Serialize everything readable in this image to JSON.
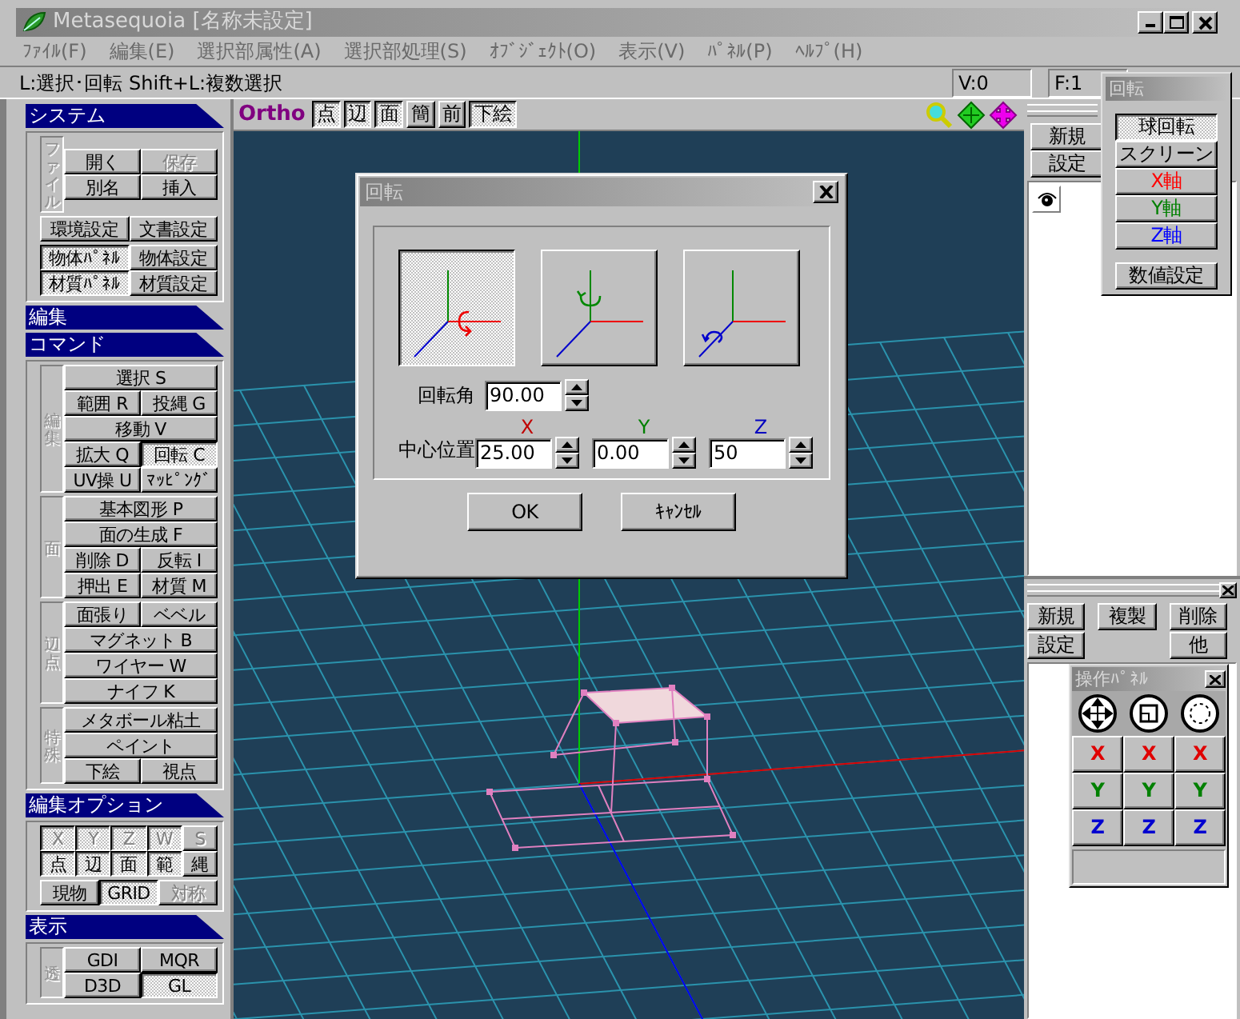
{
  "window": {
    "title": "Metasequoia [名称未設定]"
  },
  "menu": [
    "ﾌｧｲﾙ(F)",
    "編集(E)",
    "選択部属性(A)",
    "選択部処理(S)",
    "ｵﾌﾞｼﾞｪｸﾄ(O)",
    "表示(V)",
    "ﾊﾟﾈﾙ(P)",
    "ﾍﾙﾌﾟ(H)"
  ],
  "status": {
    "hint": "L:選択･回転  Shift+L:複数選択",
    "vertex_count": "V:0",
    "face_count": "F:1"
  },
  "sidebar": [
    {
      "title": "システム",
      "groups": [
        {
          "label": "ファイル",
          "rows": [
            [
              {
                "label": "開く",
                "pressed": false,
                "disabled": false
              },
              {
                "label": "保存",
                "pressed": false,
                "disabled": true
              }
            ],
            [
              {
                "label": "別名",
                "pressed": false,
                "disabled": false
              },
              {
                "label": "挿入",
                "pressed": false,
                "disabled": false
              }
            ]
          ]
        },
        {
          "rows": [
            [
              {
                "label": "環境設定",
                "pressed": false,
                "disabled": false
              },
              {
                "label": "文書設定",
                "pressed": false,
                "disabled": false
              }
            ]
          ]
        },
        {
          "rows": [
            [
              {
                "label": "物体ﾊﾟﾈﾙ",
                "pressed": true,
                "disabled": false
              },
              {
                "label": "物体設定",
                "pressed": false,
                "disabled": false
              }
            ],
            [
              {
                "label": "材質ﾊﾟﾈﾙ",
                "pressed": true,
                "disabled": false
              },
              {
                "label": "材質設定",
                "pressed": false,
                "disabled": false
              }
            ]
          ]
        }
      ]
    },
    {
      "title": "編集"
    },
    {
      "title": "コマンド",
      "groups": [
        {
          "label": "編集",
          "rows": [
            [
              {
                "label": "選択 S",
                "pressed": false,
                "disabled": false
              }
            ],
            [
              {
                "label": "範囲 R",
                "pressed": false,
                "disabled": false
              },
              {
                "label": "投縄 G",
                "pressed": false,
                "disabled": false
              }
            ],
            [
              {
                "label": "移動 V",
                "pressed": false,
                "disabled": false
              }
            ],
            [
              {
                "label": "拡大 Q",
                "pressed": false,
                "disabled": false
              },
              {
                "label": "回転 C",
                "pressed": true,
                "disabled": false
              }
            ],
            [
              {
                "label": "UV操 U",
                "pressed": false,
                "disabled": false
              },
              {
                "label": "ﾏｯﾋﾟﾝｸﾞ",
                "pressed": false,
                "disabled": false
              }
            ]
          ]
        },
        {
          "label": "面",
          "rows": [
            [
              {
                "label": "基本図形 P",
                "pressed": false,
                "disabled": false
              }
            ],
            [
              {
                "label": "面の生成 F",
                "pressed": false,
                "disabled": false
              }
            ],
            [
              {
                "label": "削除 D",
                "pressed": false,
                "disabled": false
              },
              {
                "label": "反転 I",
                "pressed": false,
                "disabled": false
              }
            ],
            [
              {
                "label": "押出 E",
                "pressed": false,
                "disabled": false
              },
              {
                "label": "材質 M",
                "pressed": false,
                "disabled": false
              }
            ]
          ]
        },
        {
          "label": "辺・点",
          "rows": [
            [
              {
                "label": "面張り",
                "pressed": false,
                "disabled": false
              },
              {
                "label": "ベベル",
                "pressed": false,
                "disabled": false
              }
            ],
            [
              {
                "label": "マグネット B",
                "pressed": false,
                "disabled": false
              }
            ],
            [
              {
                "label": "ワイヤー W",
                "pressed": false,
                "disabled": false
              }
            ],
            [
              {
                "label": "ナイフ K",
                "pressed": false,
                "disabled": false
              }
            ]
          ]
        },
        {
          "label": "特殊",
          "rows": [
            [
              {
                "label": "メタボール粘土",
                "pressed": false,
                "disabled": false
              }
            ],
            [
              {
                "label": "ペイント",
                "pressed": false,
                "disabled": false
              }
            ],
            [
              {
                "label": "下絵",
                "pressed": false,
                "disabled": false
              },
              {
                "label": "視点",
                "pressed": false,
                "disabled": false
              }
            ]
          ]
        }
      ]
    },
    {
      "title": "編集オプション",
      "groups": [
        {
          "rows": [
            [
              {
                "label": "X",
                "pressed": true,
                "disabled": true
              },
              {
                "label": "Y",
                "pressed": true,
                "disabled": true
              },
              {
                "label": "Z",
                "pressed": true,
                "disabled": true
              },
              {
                "label": "W",
                "pressed": true,
                "disabled": true
              },
              {
                "label": "S",
                "pressed": false,
                "disabled": true
              }
            ],
            [
              {
                "label": "点",
                "pressed": true,
                "disabled": false
              },
              {
                "label": "辺",
                "pressed": true,
                "disabled": false
              },
              {
                "label": "面",
                "pressed": true,
                "disabled": false
              },
              {
                "label": "範",
                "pressed": true,
                "disabled": false
              },
              {
                "label": "縄",
                "pressed": false,
                "disabled": false
              }
            ]
          ]
        },
        {
          "rows": [
            [
              {
                "label": "現物",
                "pressed": false,
                "disabled": false
              },
              {
                "label": "GRID",
                "pressed": true,
                "disabled": false
              },
              {
                "label": "対称",
                "pressed": false,
                "disabled": true
              }
            ]
          ]
        }
      ]
    },
    {
      "title": "表示",
      "groups": [
        {
          "label": "透",
          "rows": [
            [
              {
                "label": "GDI",
                "pressed": false,
                "disabled": false
              },
              {
                "label": "MQR",
                "pressed": false,
                "disabled": false
              }
            ],
            [
              {
                "label": "D3D",
                "pressed": false,
                "disabled": false
              },
              {
                "label": "GL",
                "pressed": true,
                "disabled": false
              }
            ]
          ]
        }
      ]
    }
  ],
  "viewport": {
    "projection": "Ortho",
    "buttons": [
      {
        "label": "点",
        "pressed": true
      },
      {
        "label": "辺",
        "pressed": true
      },
      {
        "label": "面",
        "pressed": true
      },
      {
        "label": "簡",
        "pressed": false
      },
      {
        "label": "前",
        "pressed": false
      },
      {
        "label": "下絵",
        "pressed": true
      }
    ]
  },
  "dialog": {
    "title": "回転",
    "axis_options": [
      {
        "kind": "x",
        "selected": true
      },
      {
        "kind": "y",
        "selected": false
      },
      {
        "kind": "z",
        "selected": false
      }
    ],
    "angle": {
      "label": "回転角",
      "value": "90.00"
    },
    "center": {
      "label": "中心位置",
      "fields": [
        {
          "axis": "X",
          "color": "#c00000",
          "value": "25.00"
        },
        {
          "axis": "Y",
          "color": "#008000",
          "value": "0.00"
        },
        {
          "axis": "Z",
          "color": "#0000c0",
          "value": "50"
        }
      ]
    },
    "buttons": [
      "OK",
      "ｷｬﾝｾﾙ"
    ]
  },
  "object_panel": {
    "buttons": [
      "新規",
      "設定"
    ],
    "objects": [
      {
        "visible": true
      }
    ]
  },
  "rotate_panel": {
    "title": "回転",
    "modes": [
      {
        "label": "球回転",
        "selected": true,
        "color": "#000000"
      },
      {
        "label": "スクリーン",
        "selected": false,
        "color": "#000000"
      },
      {
        "label": "X軸",
        "selected": false,
        "color": "#ff0000"
      },
      {
        "label": "Y軸",
        "selected": false,
        "color": "#008000"
      },
      {
        "label": "Z軸",
        "selected": false,
        "color": "#0000ff"
      }
    ],
    "numeric_button": "数値設定"
  },
  "material_panel": {
    "rows": [
      [
        "新規",
        "複製",
        "削除"
      ],
      [
        "設定",
        "",
        "他"
      ]
    ]
  },
  "operation_panel": {
    "title": "操作ﾊﾟﾈﾙ",
    "tools": [
      {
        "kind": "move"
      },
      {
        "kind": "scale"
      },
      {
        "kind": "rotate"
      }
    ],
    "axis_rows": [
      {
        "color": "#e00000",
        "cells": [
          "X",
          "X",
          "X"
        ]
      },
      {
        "color": "#008000",
        "cells": [
          "Y",
          "Y",
          "Y"
        ]
      },
      {
        "color": "#0000d0",
        "cells": [
          "Z",
          "Z",
          "Z"
        ]
      }
    ]
  }
}
